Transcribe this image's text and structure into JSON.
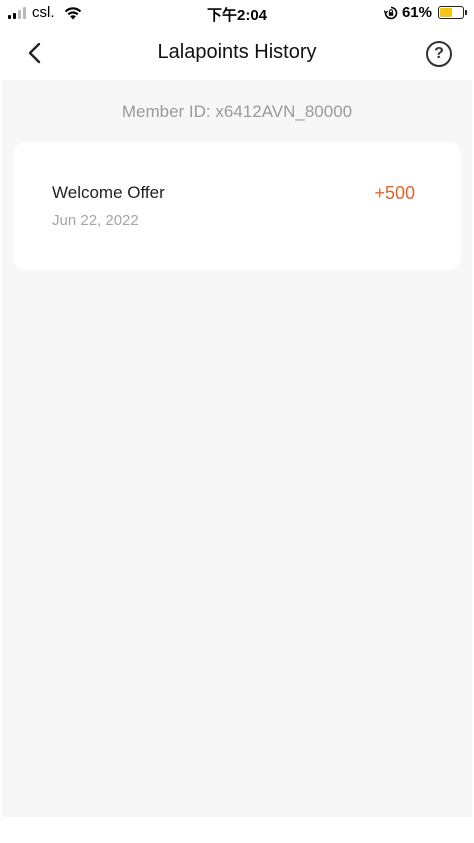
{
  "status_bar": {
    "carrier": "csl.",
    "time": "下午2:04",
    "battery_percent": "61%",
    "battery_level": 0.61,
    "icons": [
      "signal-icon",
      "wifi-icon",
      "orientation-lock-icon",
      "battery-icon"
    ]
  },
  "nav": {
    "title": "Lalapoints History",
    "back_icon": "chevron-left-icon",
    "help_label": "?"
  },
  "member": {
    "id_text": "Member ID: x6412AVN_80000"
  },
  "history": [
    {
      "title": "Welcome Offer",
      "date": "Jun 22, 2022",
      "points": "+500"
    }
  ],
  "colors": {
    "accent": "#e0642a",
    "background": "#f7f7f7",
    "battery": "#f5c518"
  }
}
